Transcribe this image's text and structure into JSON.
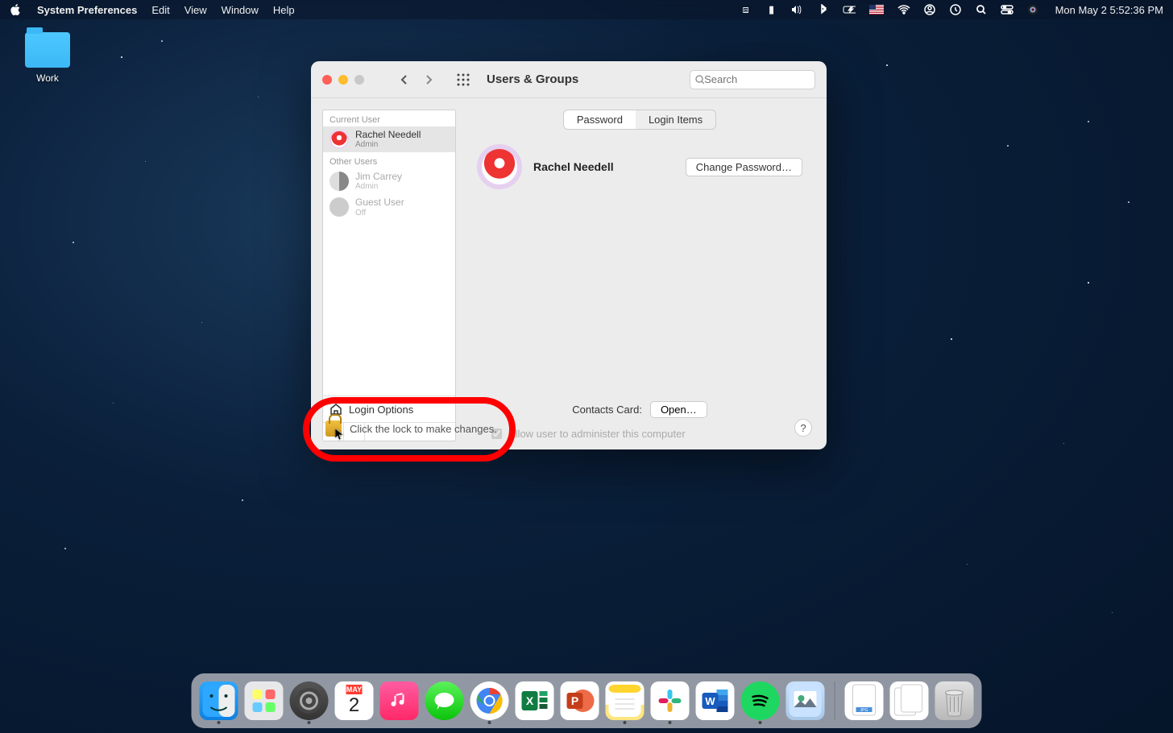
{
  "menubar": {
    "app_name": "System Preferences",
    "menus": [
      "Edit",
      "View",
      "Window",
      "Help"
    ],
    "datetime": "Mon May 2  5:52:36 PM"
  },
  "desktop": {
    "folder_label": "Work"
  },
  "window": {
    "title": "Users & Groups",
    "search_placeholder": "Search",
    "sidebar": {
      "current_user_header": "Current User",
      "other_users_header": "Other Users",
      "users": [
        {
          "name": "Rachel Needell",
          "role": "Admin",
          "selected": true,
          "dim": false
        },
        {
          "name": "Jim Carrey",
          "role": "Admin",
          "selected": false,
          "dim": true
        },
        {
          "name": "Guest User",
          "role": "Off",
          "selected": false,
          "dim": true
        }
      ],
      "login_options": "Login Options"
    },
    "tabs": {
      "password": "Password",
      "login_items": "Login Items",
      "active": "password"
    },
    "profile": {
      "name": "Rachel Needell",
      "change_password": "Change Password…"
    },
    "contacts_label": "Contacts Card:",
    "open_button": "Open…",
    "allow_admin": "Allow user to administer this computer",
    "lock_text": "Click the lock to make changes.",
    "help": "?"
  },
  "calendar": {
    "month": "MAY",
    "day": "2"
  },
  "dock_apps": [
    "finder",
    "launchpad",
    "settings",
    "calendar",
    "music",
    "messages",
    "chrome",
    "excel",
    "powerpoint",
    "notes",
    "slack",
    "word",
    "spotify",
    "preview"
  ],
  "dock_running": [
    "finder",
    "settings",
    "chrome",
    "notes",
    "slack",
    "spotify"
  ]
}
